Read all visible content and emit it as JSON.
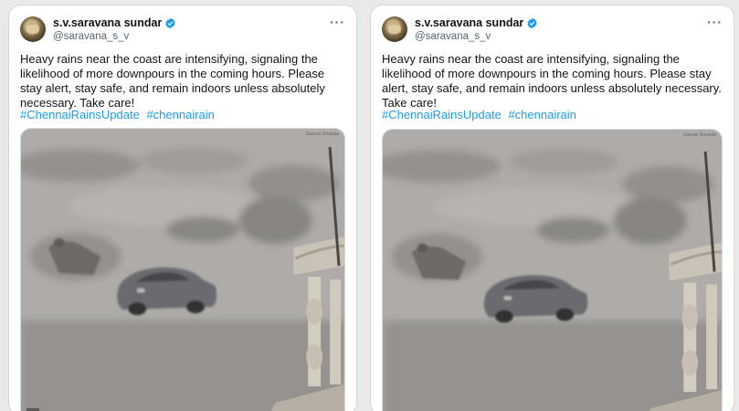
{
  "posts": [
    {
      "display_name": "s.v.saravana sundar",
      "handle": "@saravana_s_v",
      "text": "Heavy rains near the coast are intensifying, signaling the likelihood of more downpours in the coming hours. Please stay alert, stay safe, and remain indoors unless absolutely necessary. Take care!",
      "hashtags": [
        "#ChennaiRainsUpdate",
        "#chennairain"
      ],
      "more_label": "···",
      "media_watermark": "Gaurav Srivasta"
    },
    {
      "display_name": "s.v.saravana sundar",
      "handle": "@saravana_s_v",
      "text": "Heavy rains near the coast are intensifying, signaling the likelihood of more downpours in the coming hours. Please stay alert, stay safe, and remain indoors unless absolutely necessary. Take care!",
      "hashtags": [
        "#ChennaiRainsUpdate",
        "#chennairain"
      ],
      "more_label": "···",
      "media_watermark": "Gaurav Srivasta"
    }
  ],
  "colors": {
    "hashtag": "#1d9bf0",
    "verified": "#1d9bf0",
    "text": "#0f1419",
    "secondary": "#536471",
    "border": "#cfd9de"
  }
}
